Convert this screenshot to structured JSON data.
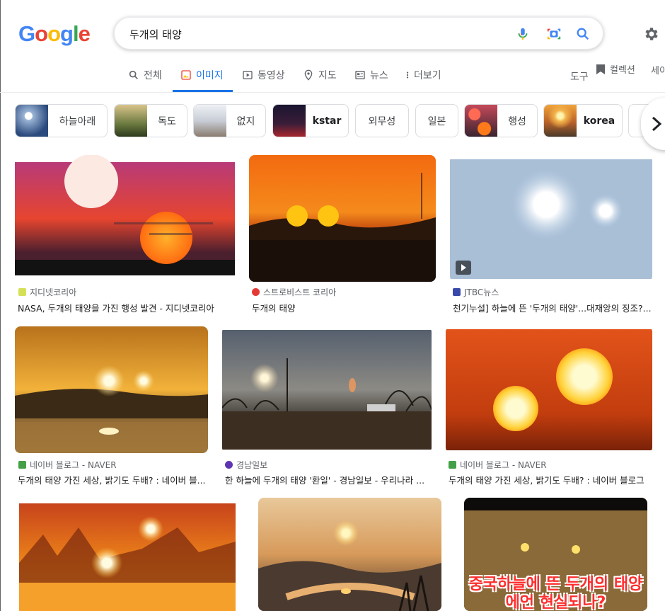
{
  "logo": [
    "G",
    "o",
    "o",
    "g",
    "l",
    "e"
  ],
  "logo_colors": [
    "#4285f4",
    "#ea4335",
    "#fbbc05",
    "#4285f4",
    "#34a853",
    "#ea4335"
  ],
  "search": {
    "query": "두개의 태양"
  },
  "tabs": [
    {
      "label": "전체",
      "icon": "search-icon"
    },
    {
      "label": "이미지",
      "icon": "image-icon"
    },
    {
      "label": "동영상",
      "icon": "video-icon"
    },
    {
      "label": "지도",
      "icon": "map-pin-icon"
    },
    {
      "label": "뉴스",
      "icon": "news-icon"
    },
    {
      "label": "더보기",
      "icon": "more-vert-icon"
    }
  ],
  "toolbar": {
    "tools": "도구",
    "collections": "컬렉션",
    "safesearch": "세이"
  },
  "chips": [
    "하늘아래",
    "독도",
    "없지",
    "kstar",
    "외무성",
    "일본",
    "행성",
    "korea"
  ],
  "results": [
    {
      "source": "지디넷코리아",
      "title": "NASA, 두개의 태양을 가진 행성 발견 - 지디넷코리아"
    },
    {
      "source": "스트로비스트 코리아",
      "title": "두개의 태양"
    },
    {
      "source": "JTBC뉴스",
      "title": "천기누설] 하늘에 뜬 '두개의 태양'...대재앙의 징조?..."
    },
    {
      "source": "네이버 블로그 - NAVER",
      "title": "두개의 태양 가진 세상, 밝기도 두배? : 네이버 블..."
    },
    {
      "source": "경남일보",
      "title": "한 하늘에 두개의 태양 '환일' - 경남일보 - 우리나라 ..."
    },
    {
      "source": "네이버 블로그 - NAVER",
      "title": "두개의 태양 가진 세상, 밝기도 두배? : 네이버 블로그"
    }
  ],
  "overlay": {
    "line1": "중국하늘에 뜬 두개의 태양",
    "line2": "에언 현실되나?"
  }
}
